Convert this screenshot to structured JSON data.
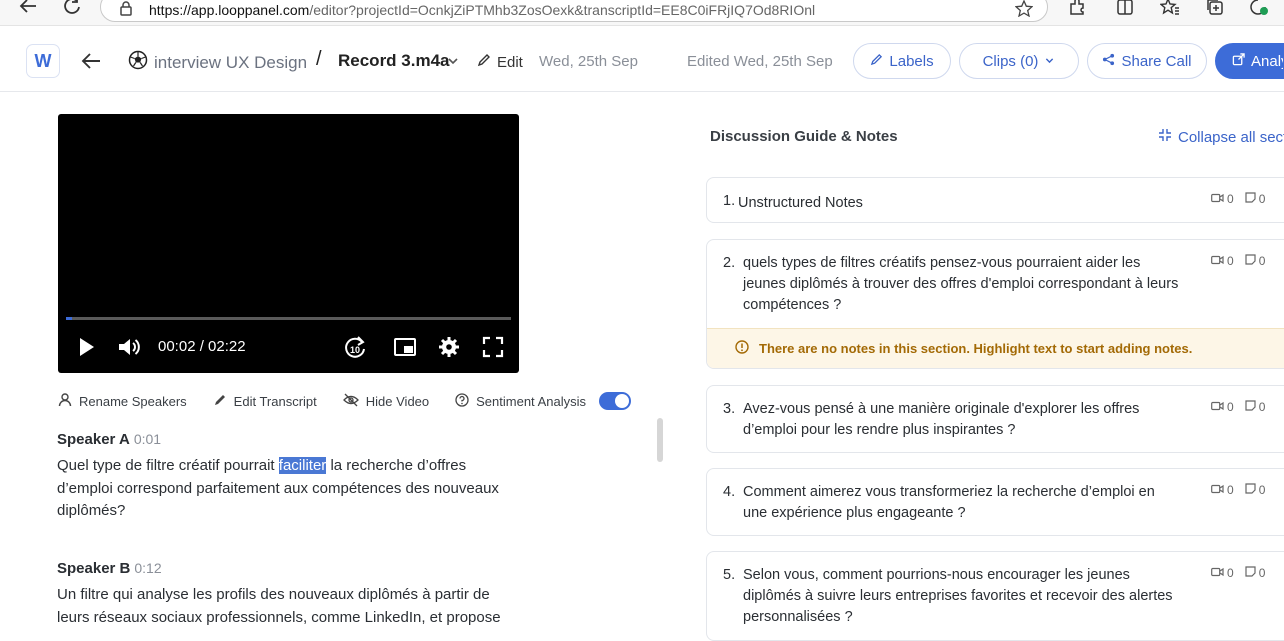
{
  "browser": {
    "url_domain": "https://app.looppanel.com",
    "url_path": "/editor?projectId=OcnkjZiPTMhb3ZosOexk&transcriptId=EE8C0iFRjIQ7Od8RIOnl"
  },
  "header": {
    "logo_letter": "W",
    "project_name": "interview UX Design",
    "separator": "/",
    "recording_name": "Record 3.m4a",
    "edit_label": "Edit",
    "date": "Wed, 25th Sep",
    "edited": "Edited Wed, 25th Sep",
    "labels_btn": "Labels",
    "clips_btn": "Clips (0)",
    "share_btn": "Share Call",
    "analyze_btn": "Analyze"
  },
  "video": {
    "time": "00:02 / 02:22",
    "progress": 0.014
  },
  "toolbar": {
    "rename": "Rename Speakers",
    "edit_transcript": "Edit Transcript",
    "hide_video": "Hide Video",
    "sentiment": "Sentiment Analysis",
    "sentiment_on": true
  },
  "transcript": [
    {
      "speaker": "Speaker A",
      "time": "0:01",
      "text_before": "Quel type de filtre créatif pourrait ",
      "highlight": "faciliter",
      "text_after": " la recherche d’offres d’emploi correspond parfaitement aux compétences des nouveaux diplômés?"
    },
    {
      "speaker": "Speaker B",
      "time": "0:12",
      "text": "Un filtre qui analyse les profils des nouveaux diplômés à partir de leurs réseaux sociaux professionnels, comme LinkedIn, et propose"
    }
  ],
  "guide": {
    "title": "Discussion Guide & Notes",
    "collapse_label": "Collapse all sections",
    "no_notes_msg": "There are no notes in this section. Highlight text to start adding notes.",
    "sections": [
      {
        "num": "1.",
        "text": "Unstructured Notes",
        "clips": "0",
        "notes": "0"
      },
      {
        "num": "2.",
        "text": "quels types de filtres créatifs pensez-vous pourraient aider les jeunes diplômés à trouver des offres d'emploi correspondant à leurs compétences ?",
        "clips": "0",
        "notes": "0"
      },
      {
        "num": "3.",
        "text": "Avez-vous pensé à une manière originale d'explorer les offres d’emploi pour les rendre plus inspirantes ?",
        "clips": "0",
        "notes": "0"
      },
      {
        "num": "4.",
        "text": "Comment aimerez vous transformeriez la recherche d’emploi en une expérience plus engageante ?",
        "clips": "0",
        "notes": "0"
      },
      {
        "num": "5.",
        "text": "Selon vous, comment pourrions-nous encourager les jeunes diplômés à suivre leurs entreprises favorites et recevoir des alertes personnalisées ?",
        "clips": "0",
        "notes": "0"
      }
    ]
  },
  "colors": {
    "accent": "#3d6cd8",
    "warning_bg": "#fdf6e7",
    "warning_text": "#a36a06"
  }
}
